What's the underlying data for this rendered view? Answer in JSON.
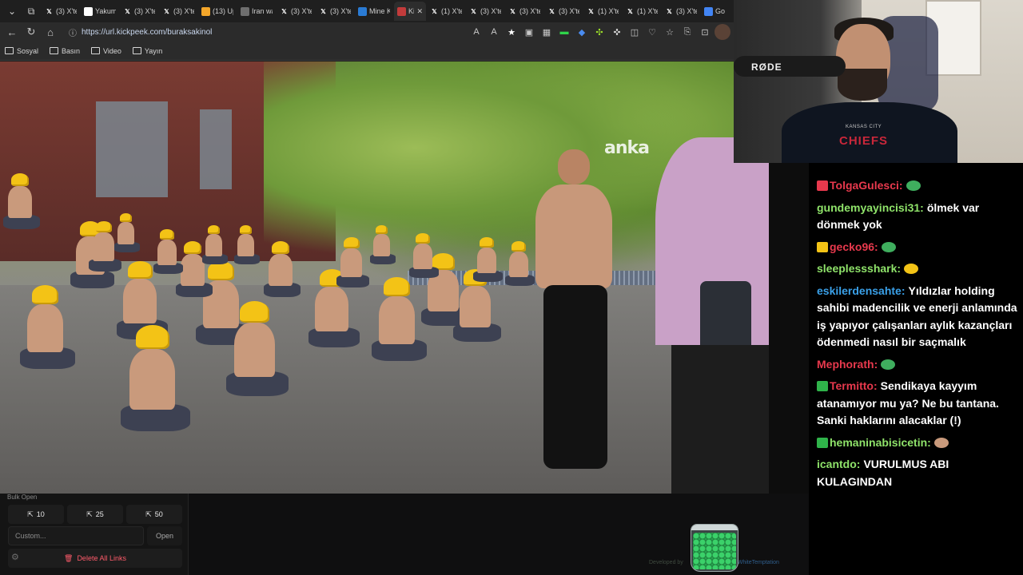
{
  "browser": {
    "tabs": [
      {
        "label": "(3) X'te",
        "icon": "x-logo",
        "color": "#000000"
      },
      {
        "label": "Yakum",
        "icon": "yakum-favicon",
        "color": "#ffffff"
      },
      {
        "label": "(3) X'te",
        "icon": "x-logo",
        "color": "#000000"
      },
      {
        "label": "(3) X'te",
        "icon": "x-logo",
        "color": "#000000"
      },
      {
        "label": "(13) Up",
        "icon": "up-favicon",
        "color": "#f4a62a"
      },
      {
        "label": "Iran wa",
        "icon": "globe-favicon",
        "color": "#6f6f6f"
      },
      {
        "label": "(3) X'te",
        "icon": "x-logo",
        "color": "#000000"
      },
      {
        "label": "(3) X'te",
        "icon": "x-logo",
        "color": "#000000"
      },
      {
        "label": "Mine K",
        "icon": "mine-favicon",
        "color": "#2a7bd4"
      },
      {
        "label": "Kic",
        "icon": "kickpeek-favicon",
        "color": "#c23b3b",
        "active": true
      },
      {
        "label": "(1) X'te",
        "icon": "x-logo",
        "color": "#000000"
      },
      {
        "label": "(3) X'te",
        "icon": "x-logo",
        "color": "#000000"
      },
      {
        "label": "(3) X'te",
        "icon": "x-logo",
        "color": "#000000"
      },
      {
        "label": "(3) X'te",
        "icon": "x-logo",
        "color": "#000000"
      },
      {
        "label": "(1) X'te",
        "icon": "x-logo",
        "color": "#000000"
      },
      {
        "label": "(1) X'te",
        "icon": "x-logo",
        "color": "#000000"
      },
      {
        "label": "(3) X'te",
        "icon": "x-logo",
        "color": "#000000"
      },
      {
        "label": "Go",
        "icon": "google-favicon",
        "color": "#4285f4"
      }
    ],
    "active_tab_close": "✕",
    "new_tab": "+",
    "url": "https://url.kickpeek.com/buraksakinol",
    "bookmarks": [
      {
        "label": "Sosyal"
      },
      {
        "label": "Basın"
      },
      {
        "label": "Video"
      },
      {
        "label": "Yayın"
      }
    ]
  },
  "video": {
    "watermark": "anka"
  },
  "bulk_open": {
    "title": "Bulk Open",
    "buttons": [
      {
        "label": "10"
      },
      {
        "label": "25"
      },
      {
        "label": "50"
      }
    ],
    "custom_placeholder": "Custom...",
    "open_label": "Open",
    "delete_label": "Delete All Links"
  },
  "footer": {
    "developed_by": "Developed by",
    "credit_link": "WhiteTemptation"
  },
  "webcam": {
    "mic_brand": "RØDE",
    "shirt_text_top": "KANSAS CITY",
    "shirt_text": "CHIEFS"
  },
  "chat": {
    "messages": [
      {
        "user": "TolgaGulesci",
        "color": "#e8394d",
        "badge": "#e8394d",
        "text": "",
        "emote": "#3fae5e"
      },
      {
        "user": "gundemyayincisi31",
        "color": "#8fe36a",
        "badge": "",
        "text": "ölmek var dönmek yok",
        "emote": ""
      },
      {
        "user": "gecko96",
        "color": "#e8394d",
        "badge": "#f3c316",
        "text": "",
        "emote": "#3fae5e"
      },
      {
        "user": "sleeplessshark",
        "color": "#8fe36a",
        "badge": "",
        "text": "",
        "emote": "#f3c316"
      },
      {
        "user": "eskilerdensahte",
        "color": "#3aa0e8",
        "badge": "",
        "text": "Yıldızlar holding sahibi madencilik ve enerji anlamında iş yapıyor çalışanları aylık kazançları ödenmedi nasıl bir saçmalık",
        "emote": ""
      },
      {
        "user": "Mephorath",
        "color": "#e8394d",
        "badge": "",
        "text": "",
        "emote": "#3fae5e"
      },
      {
        "user": "Termitto",
        "color": "#e8394d",
        "badge": "#2fb34a",
        "text": "Sendikaya kayyım atanamıyor mu ya? Ne bu tantana. Sanki haklarını alacaklar (!)",
        "emote": ""
      },
      {
        "user": "hemaninabisicetin",
        "color": "#8fe36a",
        "badge": "#2fb34a",
        "text": "",
        "emote": "#c99a7c"
      },
      {
        "user": "icantdo",
        "color": "#8fe36a",
        "badge": "",
        "text": "VURULMUS ABI KULAGINDAN",
        "emote": ""
      }
    ]
  }
}
